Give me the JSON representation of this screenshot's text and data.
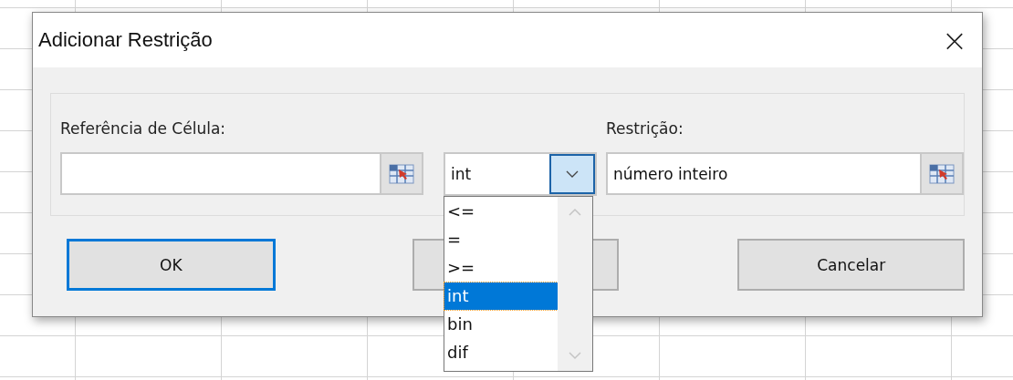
{
  "window": {
    "title": "Adicionar Restrição",
    "close": "×"
  },
  "cell_reference": {
    "label": "Referência de Célula:"
  },
  "operator": {
    "value": "int",
    "expanded": true,
    "options": [
      {
        "label": "<=",
        "selected": false
      },
      {
        "label": "=",
        "selected": false
      },
      {
        "label": ">=",
        "selected": false
      },
      {
        "label": "int",
        "selected": true
      },
      {
        "label": "bin",
        "selected": false
      },
      {
        "label": "dif",
        "selected": false
      }
    ]
  },
  "constraint": {
    "label": "Restrição:",
    "value": "número inteiro"
  },
  "buttons": [
    {
      "label": "OK",
      "kind": "default"
    },
    {
      "kind": "covered"
    },
    {
      "label": "Cancelar",
      "kind": "normal"
    }
  ]
}
